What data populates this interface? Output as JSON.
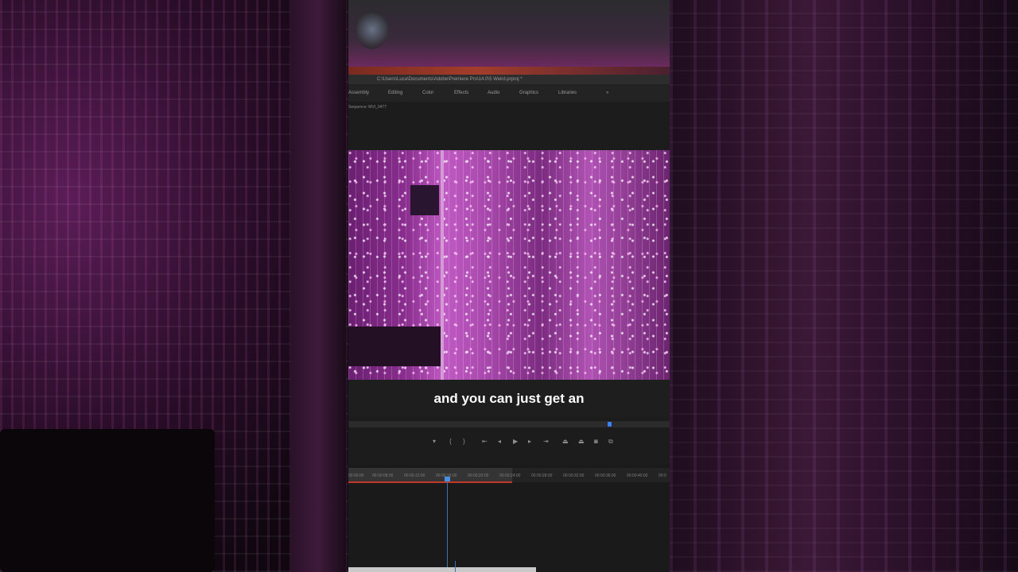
{
  "window": {
    "title_path": "C:\\Users\\Luca\\Documents\\Adobe\\Premiere Pro\\14.0\\5 Weird.prproj *"
  },
  "workspace_tabs": [
    "Assembly",
    "Editing",
    "Color",
    "Effects",
    "Audio",
    "Graphics",
    "Libraries",
    "»"
  ],
  "sequence_label": "Sequence: MVI_0477",
  "caption": "and you can just get an",
  "timecodes": [
    "00:00:00",
    "00:00:08:00",
    "00:00:12:00",
    "00:00:16:00",
    "00:00:20:00",
    "00:00:24:00",
    "00:00:28:00",
    "00:00:32:00",
    "00:00:36:00",
    "00:00:40:00",
    "00:0"
  ],
  "controls": {
    "marker": "▾",
    "mark_in": "{",
    "mark_out": "}",
    "go_to_in": "⇤",
    "step_back": "◂",
    "play": "▶",
    "step_forward": "▸",
    "go_to_out": "⇥",
    "lift": "⏏",
    "extract": "⏏",
    "export_frame": "◙",
    "button_editor": "⧉"
  },
  "colors": {
    "accent": "#3b82f6",
    "in_out_range": "#c0392b"
  }
}
